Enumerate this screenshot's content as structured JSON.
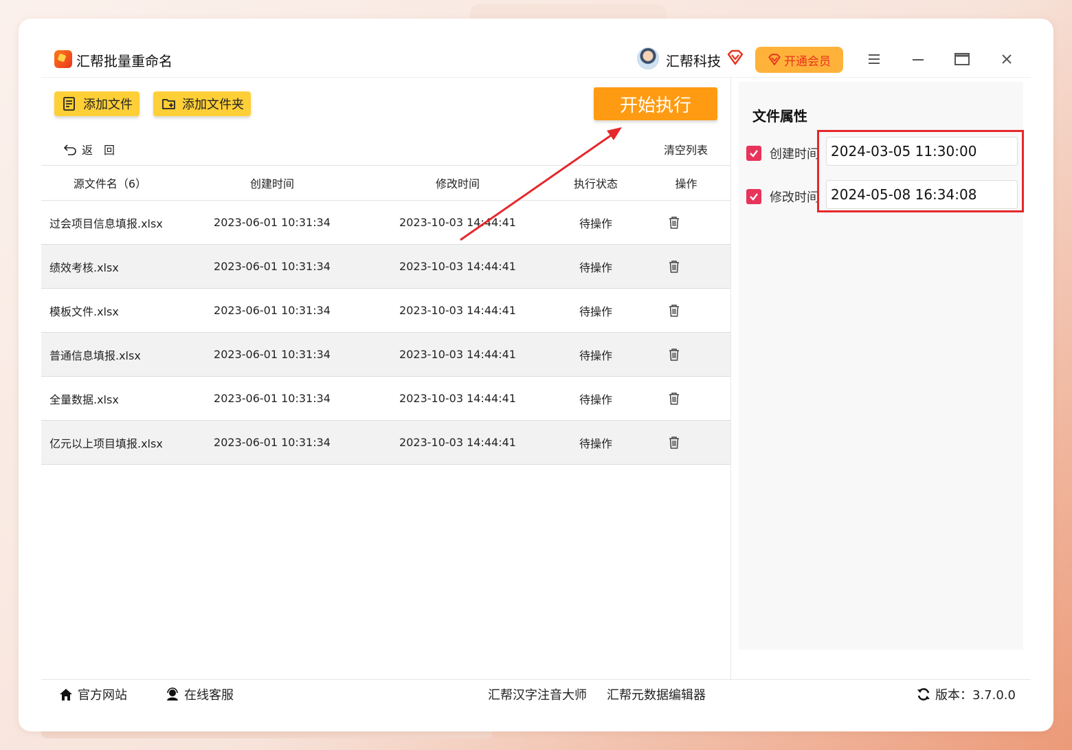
{
  "app": {
    "title": "汇帮批量重命名"
  },
  "user": {
    "name": "汇帮科技"
  },
  "vip": {
    "label": "开通会员"
  },
  "toolbar": {
    "add_file": "添加文件",
    "add_folder": "添加文件夹",
    "start": "开始执行",
    "back": "返　回",
    "clear": "清空列表"
  },
  "table": {
    "headers": [
      "源文件名（6）",
      "创建时间",
      "修改时间",
      "执行状态",
      "操作"
    ],
    "rows": [
      {
        "name": "过会项目信息填报.xlsx",
        "created": "2023-06-01 10:31:34",
        "modified": "2023-10-03 14:44:41",
        "status": "待操作"
      },
      {
        "name": "绩效考核.xlsx",
        "created": "2023-06-01 10:31:34",
        "modified": "2023-10-03 14:44:41",
        "status": "待操作"
      },
      {
        "name": "模板文件.xlsx",
        "created": "2023-06-01 10:31:34",
        "modified": "2023-10-03 14:44:41",
        "status": "待操作"
      },
      {
        "name": "普通信息填报.xlsx",
        "created": "2023-06-01 10:31:34",
        "modified": "2023-10-03 14:44:41",
        "status": "待操作"
      },
      {
        "name": "全量数据.xlsx",
        "created": "2023-06-01 10:31:34",
        "modified": "2023-10-03 14:44:41",
        "status": "待操作"
      },
      {
        "name": "亿元以上项目填报.xlsx",
        "created": "2023-06-01 10:31:34",
        "modified": "2023-10-03 14:44:41",
        "status": "待操作"
      }
    ]
  },
  "file_props": {
    "title": "文件属性",
    "created_label": "创建时间",
    "created_value": "2024-03-05 11:30:00",
    "created_checked": true,
    "modified_label": "修改时间",
    "modified_value": "2024-05-08 16:34:08",
    "modified_checked": true
  },
  "footer": {
    "website": "官方网站",
    "support": "在线客服",
    "pinyin_tool": "汇帮汉字注音大师",
    "metadata_tool": "汇帮元数据编辑器",
    "version": "版本：3.7.0.0"
  },
  "colors": {
    "accent_orange": "#ff9b12",
    "button_yellow": "#ffcf37",
    "checkbox_red": "#e8335a",
    "highlight_red": "#e5272b"
  }
}
